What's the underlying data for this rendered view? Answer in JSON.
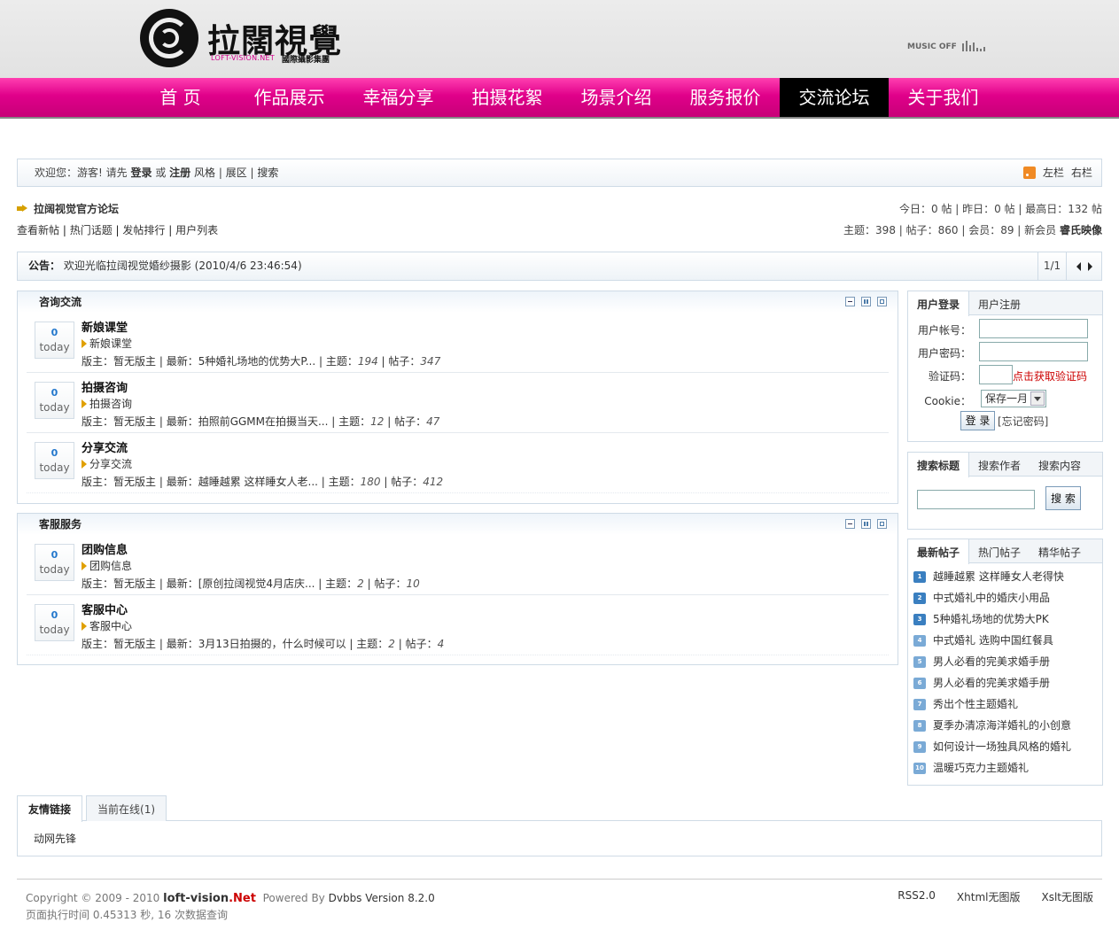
{
  "header": {
    "logo_title": "拉闊視覺",
    "logo_sub_en": "LOFT-VISION.NET",
    "logo_sub_cn": "國際攝影集團",
    "music": "MUSIC OFF"
  },
  "nav": {
    "items": [
      "首  页",
      "作品展示",
      "幸福分享",
      "拍摄花絮",
      "场景介绍",
      "服务报价",
      "交流论坛",
      "关于我们"
    ],
    "active": "交流论坛"
  },
  "welcome": {
    "greet": "欢迎您：游客!",
    "prompt": "请先",
    "login": "登录",
    "or": "或",
    "register": "注册",
    "style": "风格",
    "showroom": "展区",
    "search": "搜索",
    "left": "左栏",
    "right": "右栏"
  },
  "forum": {
    "title": "拉阔视觉官方论坛",
    "today": "今日：0 帖 | 昨日：0 帖 | 最高日：132 帖",
    "quick_links": [
      "查看新帖",
      "热门话题",
      "发帖排行",
      "用户列表"
    ],
    "stats": "主题：398 | 帖子：860 | 会员：89 | 新会员",
    "newest_member": "睿氏映像"
  },
  "notice": {
    "label": "公告：",
    "text": "欢迎光临拉阔视觉婚纱摄影 (2010/4/6 23:46:54)",
    "page": "1/1"
  },
  "categories": [
    {
      "title": "咨询交流",
      "boards": [
        {
          "count": "0",
          "when": "today",
          "name": "新娘课堂",
          "sub": "新娘课堂",
          "moderator": "版主：暂无版主",
          "latest": "最新：5种婚礼场地的优势大P...",
          "topics": "194",
          "posts": "347"
        },
        {
          "count": "0",
          "when": "today",
          "name": "拍摄咨询",
          "sub": "拍摄咨询",
          "moderator": "版主：暂无版主",
          "latest": "最新：拍照前GGMM在拍摄当天...",
          "topics": "12",
          "posts": "47"
        },
        {
          "count": "0",
          "when": "today",
          "name": "分享交流",
          "sub": "分享交流",
          "moderator": "版主：暂无版主",
          "latest": "最新：越睡越累 这样睡女人老...",
          "topics": "180",
          "posts": "412"
        }
      ]
    },
    {
      "title": "客服服务",
      "boards": [
        {
          "count": "0",
          "when": "today",
          "name": "团购信息",
          "sub": "团购信息",
          "moderator": "版主：暂无版主",
          "latest": "最新：[原创拉阔视觉4月店庆...",
          "topics": "2",
          "posts": "10"
        },
        {
          "count": "0",
          "when": "today",
          "name": "客服中心",
          "sub": "客服中心",
          "moderator": "版主：暂无版主",
          "latest": "最新：3月13日拍摄的，什么时候可以",
          "topics": "2",
          "posts": "4"
        }
      ]
    }
  ],
  "board_labels": {
    "topics": "主题：",
    "posts": "帖子："
  },
  "login": {
    "tab_login": "用户登录",
    "tab_register": "用户注册",
    "account": "用户帐号：",
    "password": "用户密码：",
    "captcha": "验证码：",
    "captcha_link": "点击获取验证码",
    "cookie": "Cookie：",
    "cookie_value": "保存一月",
    "submit": "登 录",
    "forgot": "[忘记密码]"
  },
  "search": {
    "tabs": [
      "搜索标题",
      "搜索作者",
      "搜索内容"
    ],
    "button": "搜 索"
  },
  "posts": {
    "tabs": [
      "最新帖子",
      "热门帖子",
      "精华帖子"
    ],
    "items": [
      "越睡越累 这样睡女人老得快",
      "中式婚礼中的婚庆小用品",
      "5种婚礼场地的优势大PK",
      "中式婚礼 选购中国红餐具",
      "男人必看的完美求婚手册",
      "男人必看的完美求婚手册",
      "秀出个性主题婚礼",
      "夏季办清凉海洋婚礼的小创意",
      "如何设计一场独具风格的婚礼",
      "温暖巧克力主题婚礼"
    ],
    "numbers": [
      "1",
      "2",
      "3",
      "4",
      "5",
      "6",
      "7",
      "8",
      "9",
      "10"
    ]
  },
  "links": {
    "tabs": [
      "友情链接",
      "当前在线(1)"
    ],
    "items": [
      "动网先锋"
    ]
  },
  "footer": {
    "copyright": "Copyright © 2009 - 2010",
    "site_a": "loft-vision",
    "site_b": ".Net",
    "powered": "Powered By",
    "version": "Dvbbs Version 8.2.0",
    "exec": "页面执行时间 0.45313 秒, 16 次数据查询",
    "right": [
      "RSS2.0",
      "Xhtml无图版",
      "Xslt无图版"
    ]
  }
}
